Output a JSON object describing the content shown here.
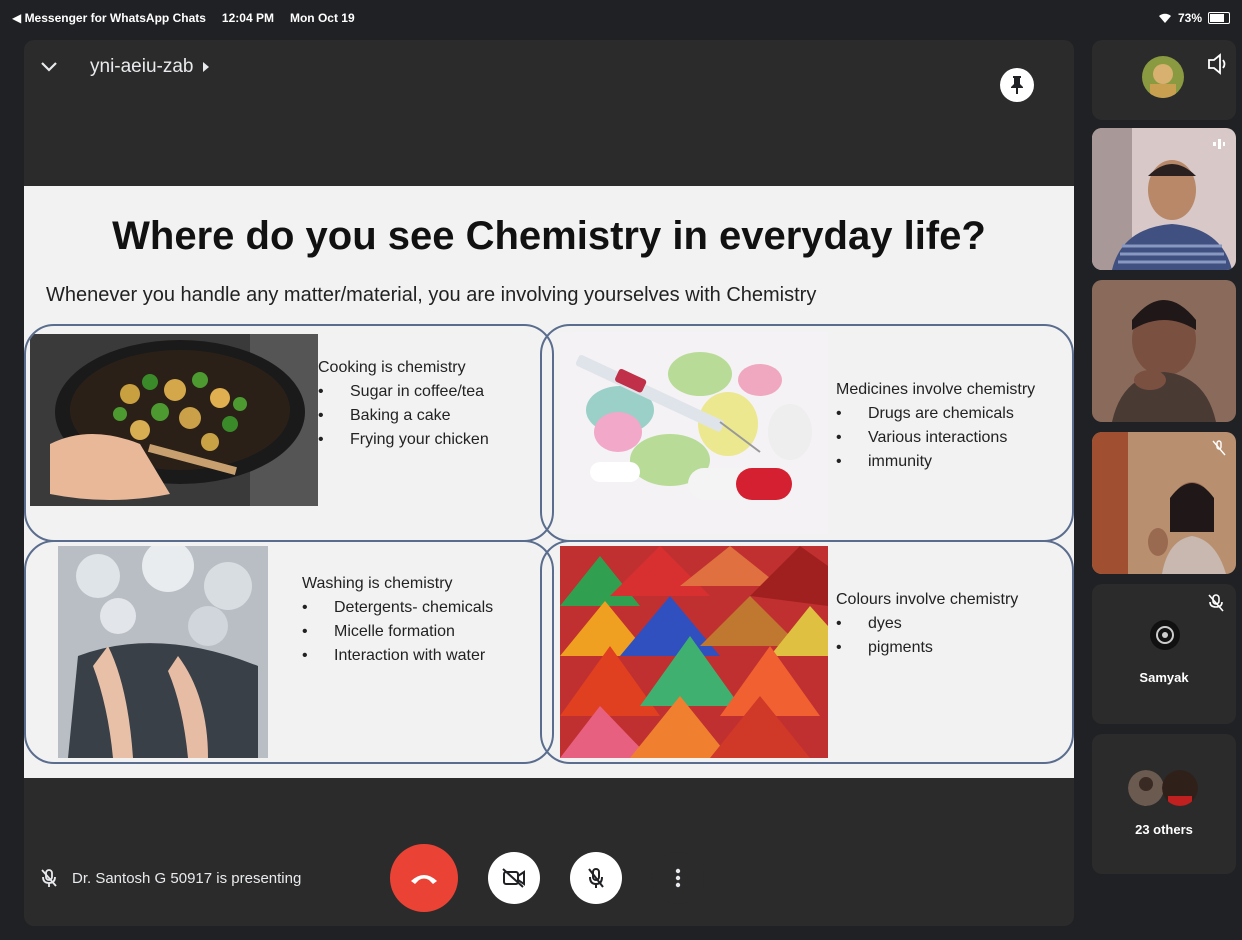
{
  "status": {
    "back_app": "◀ Messenger for WhatsApp Chats",
    "time": "12:04 PM",
    "date": "Mon Oct 19",
    "battery": "73%"
  },
  "meeting": {
    "code": "yni-aeiu-zab",
    "presenting": "Dr. Santosh G 50917 is presenting"
  },
  "slide": {
    "title": "Where do you see Chemistry in everyday life?",
    "subtitle": "Whenever you handle any matter/material, you are involving yourselves with Chemistry",
    "cells": [
      {
        "heading": "Cooking is chemistry",
        "bullets": [
          "Sugar in coffee/tea",
          "Baking a cake",
          "Frying your chicken"
        ]
      },
      {
        "heading": "Medicines involve chemistry",
        "bullets": [
          "Drugs are chemicals",
          "Various interactions",
          "immunity"
        ]
      },
      {
        "heading": "Washing is chemistry",
        "bullets": [
          "Detergents- chemicals",
          "Micelle formation",
          "Interaction with water"
        ]
      },
      {
        "heading": "Colours involve chemistry",
        "bullets": [
          "dyes",
          "pigments"
        ]
      }
    ]
  },
  "participants": {
    "samyak": "Samyak",
    "others": "23 others"
  },
  "colors": {
    "end_call": "#ea4335",
    "background": "#202124",
    "tile": "#3c4043"
  }
}
